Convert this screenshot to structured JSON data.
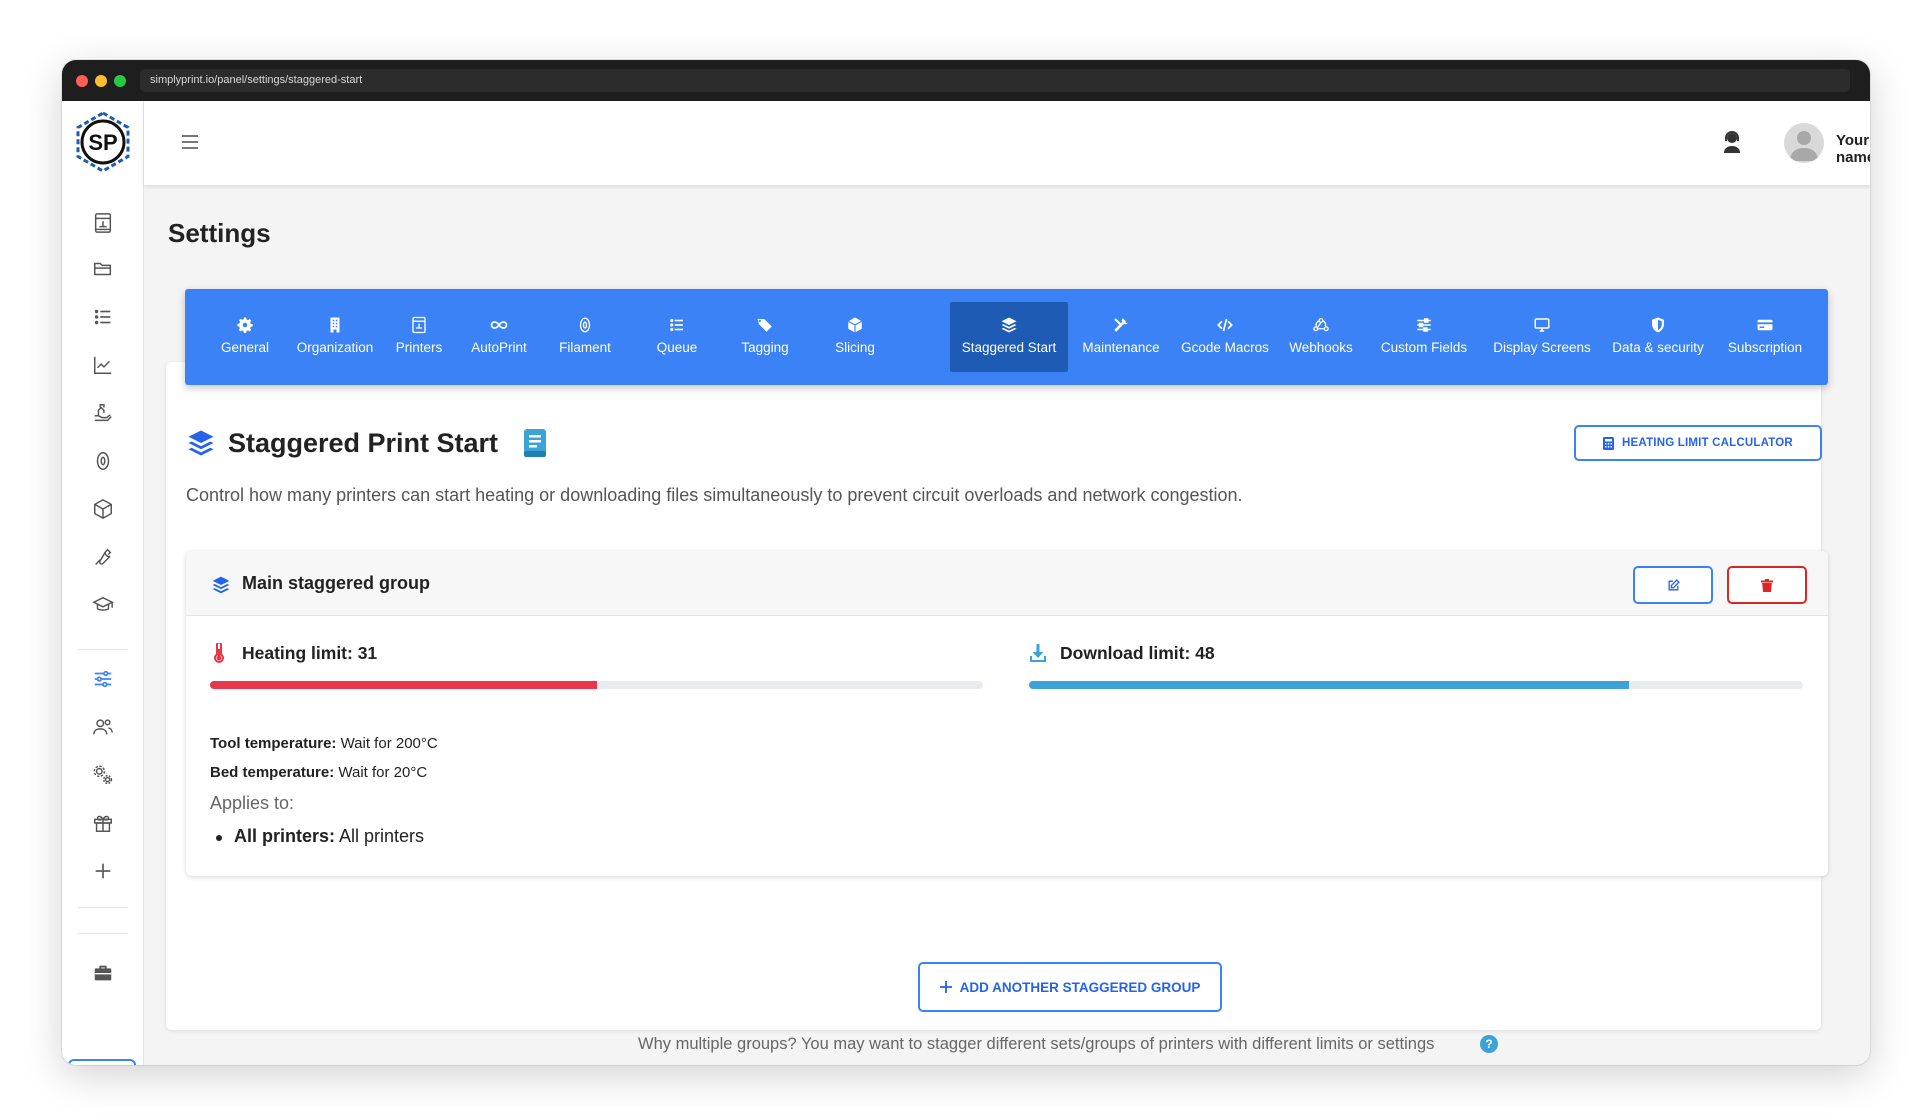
{
  "browser": {
    "url": "simplyprint.io/panel/settings/staggered-start"
  },
  "sidebar": {
    "logo_text": "SP",
    "items": [
      {
        "name": "printer-icon"
      },
      {
        "name": "folder-icon"
      },
      {
        "name": "list-icon"
      },
      {
        "name": "chart-line-icon"
      },
      {
        "name": "hand-icon"
      },
      {
        "name": "filament-icon"
      },
      {
        "name": "cube-icon"
      },
      {
        "name": "wrench-icon"
      },
      {
        "name": "graduation-cap-icon"
      },
      {
        "name": "sliders-icon",
        "active": true
      },
      {
        "name": "users-icon"
      },
      {
        "name": "gears-icon"
      },
      {
        "name": "gift-icon"
      },
      {
        "name": "plus-icon"
      },
      {
        "name": "briefcase-icon"
      }
    ],
    "favorite_icon": "★"
  },
  "topbar": {
    "user_name": "Your name"
  },
  "page": {
    "title": "Settings"
  },
  "tabs": [
    {
      "label": "General",
      "icon": "gear-icon"
    },
    {
      "label": "Organization",
      "icon": "building-icon"
    },
    {
      "label": "Printers",
      "icon": "printer-icon"
    },
    {
      "label": "AutoPrint",
      "icon": "infinity-icon"
    },
    {
      "label": "Filament",
      "icon": "filament-icon"
    },
    {
      "label": "Queue",
      "icon": "list-icon"
    },
    {
      "label": "Tagging",
      "icon": "tags-icon"
    },
    {
      "label": "Slicing",
      "icon": "cube-icon"
    },
    {
      "label": "Staggered Start",
      "icon": "layers-icon",
      "active": true
    },
    {
      "label": "Maintenance",
      "icon": "tools-icon"
    },
    {
      "label": "Gcode Macros",
      "icon": "code-icon"
    },
    {
      "label": "Webhooks",
      "icon": "webhook-icon"
    },
    {
      "label": "Custom Fields",
      "icon": "sliders-icon"
    },
    {
      "label": "Display Screens",
      "icon": "monitor-icon"
    },
    {
      "label": "Data & security",
      "icon": "shield-icon"
    },
    {
      "label": "Subscription",
      "icon": "credit-card-icon"
    }
  ],
  "section": {
    "title": "Staggered Print Start",
    "description": "Control how many printers can start heating or downloading files simultaneously to prevent circuit overloads and network congestion.",
    "calc_button": "HEATING LIMIT CALCULATOR"
  },
  "group": {
    "title": "Main staggered group",
    "heating": {
      "label": "Heating limit: 31",
      "fill_fraction": 0.5,
      "color": "#e8364a"
    },
    "download": {
      "label": "Download limit: 48",
      "fill_fraction": 0.775,
      "color": "#3ba3d8"
    },
    "tool_temp_label": "Tool temperature:",
    "tool_temp_value": " Wait for 200°C",
    "bed_temp_label": "Bed temperature:",
    "bed_temp_value": " Wait for 20°C",
    "applies_label": "Applies to:",
    "applies_item_label": "All printers:",
    "applies_item_value": " All printers"
  },
  "footer": {
    "add_button": "ADD ANOTHER STAGGERED GROUP",
    "help_text": "Why multiple groups? You may want to stagger different sets/groups of printers with different limits or settings",
    "help_icon": "?"
  },
  "colors": {
    "primary": "#3b82f6",
    "tab_active": "#1e5bb5",
    "danger": "#dc2626"
  }
}
